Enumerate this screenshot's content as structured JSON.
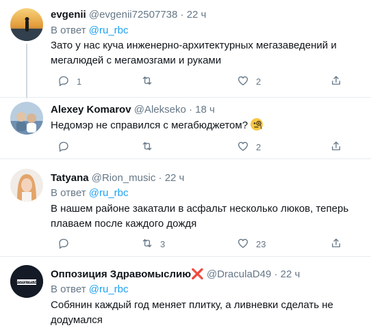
{
  "tweets": [
    {
      "name": "evgenii",
      "handle": "@evgenii72507738",
      "dot": "·",
      "time": "22 ч",
      "reply_prefix": "В ответ",
      "reply_to": "@ru_rbc",
      "text": "Зато у нас куча инженерно-архитектурных мегазаведений и мегалюдей с мегамозгами и руками",
      "replies": "1",
      "retweets": "",
      "likes": "2"
    },
    {
      "name": "Alexey Komarov",
      "handle": "@Alekseko",
      "dot": "·",
      "time": "18 ч",
      "text": "Недомэр не справился с мегабюджетом?",
      "replies": "",
      "retweets": "",
      "likes": "2"
    },
    {
      "name": "Tatyana",
      "handle": "@Rion_music",
      "dot": "·",
      "time": "22 ч",
      "reply_prefix": "В ответ",
      "reply_to": "@ru_rbc",
      "text": "В нашем районе закатали в асфальт несколько люков, теперь плаваем после каждого дождя",
      "replies": "",
      "retweets": "3",
      "likes": "23"
    },
    {
      "name": "Оппозиция Здравомыслию",
      "name_suffix": "❌",
      "handle": "@DraculaD49",
      "dot": "·",
      "time": "22 ч",
      "reply_prefix": "В ответ",
      "reply_to": "@ru_rbc",
      "text": "Собянин каждый год меняет плитку, а ливневки сделать не додумался",
      "avatar_text": "обнулись"
    }
  ],
  "colors": {
    "accent": "#1da1f2",
    "muted": "#657786",
    "text": "#0f1419",
    "separator": "#e6ecf0"
  },
  "icons": [
    "reply-icon",
    "retweet-icon",
    "like-icon",
    "share-icon"
  ]
}
